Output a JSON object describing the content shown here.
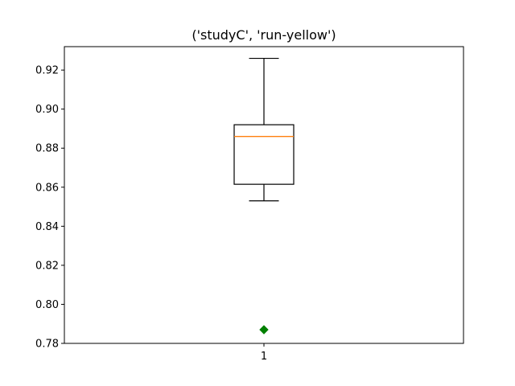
{
  "chart_data": {
    "type": "box",
    "title": "('studyC', 'run-yellow')",
    "xlabel": "",
    "ylabel": "",
    "categories": [
      "1"
    ],
    "ylim": [
      0.78,
      0.932
    ],
    "yticks": [
      "0.78",
      "0.80",
      "0.82",
      "0.84",
      "0.86",
      "0.88",
      "0.90",
      "0.92"
    ],
    "boxes": [
      {
        "category": "1",
        "whisker_low": 0.853,
        "q1": 0.8615,
        "median": 0.886,
        "q3": 0.892,
        "whisker_high": 0.926,
        "outliers": [
          0.787
        ]
      }
    ],
    "colors": {
      "box": "#000000",
      "median": "#ff7f0e",
      "outlier": "#008000"
    },
    "outlier_marker": "diamond",
    "grid": false
  }
}
